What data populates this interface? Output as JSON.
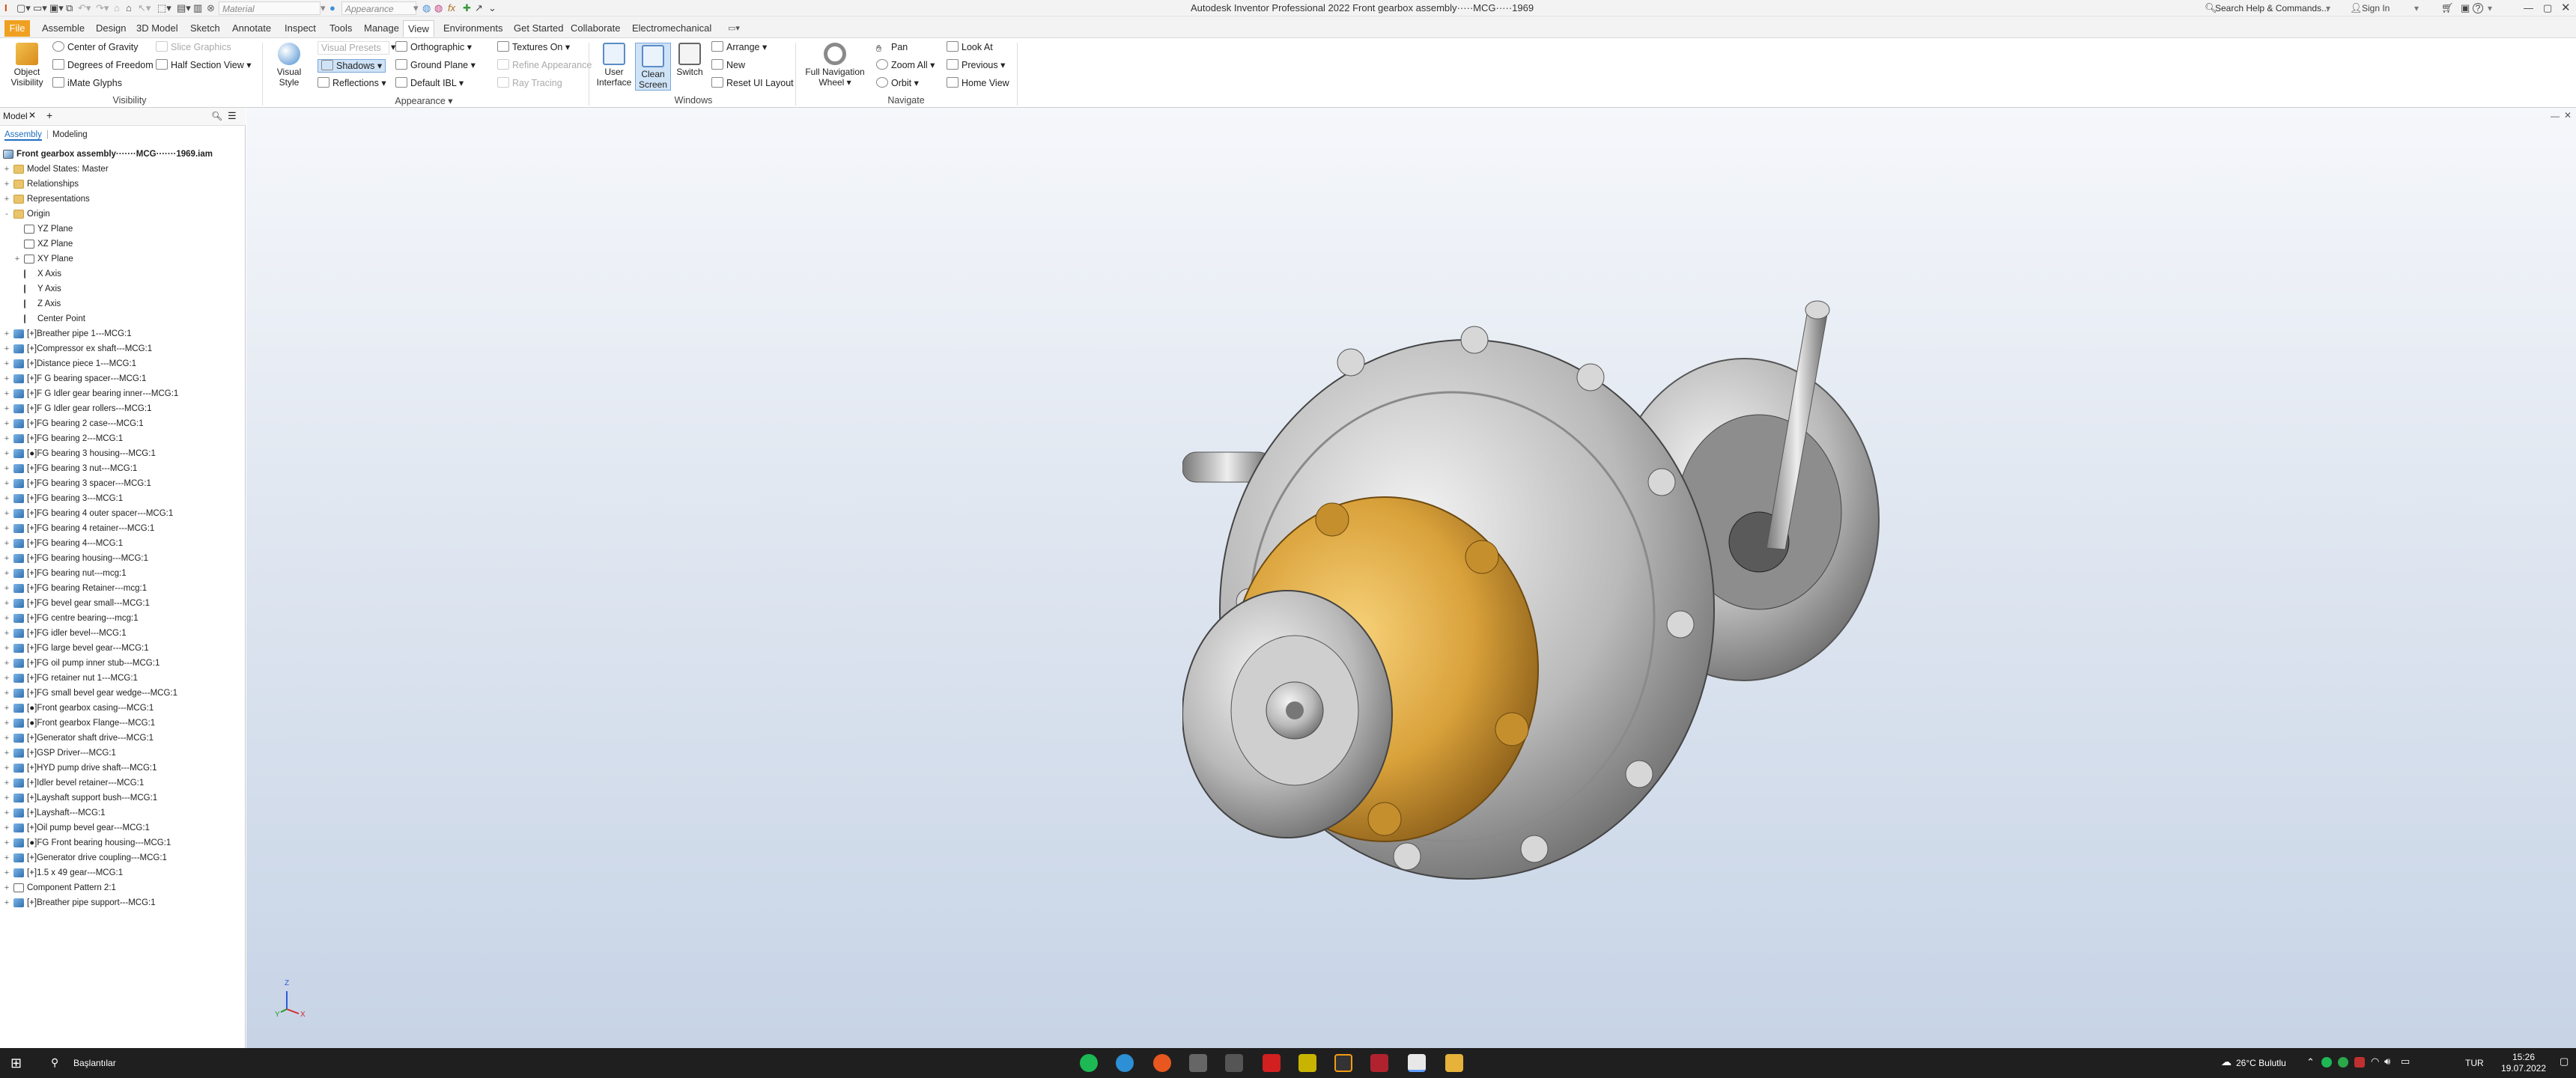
{
  "quick_access": {
    "material_dropdown": "Material",
    "appearance_dropdown": "Appearance"
  },
  "window": {
    "title": "Autodesk Inventor Professional 2022   Front gearbox assembly·····MCG·····1969",
    "search_placeholder": "Search Help & Commands...",
    "sign_in": "Sign In",
    "help": "?"
  },
  "tabs": [
    "File",
    "Assemble",
    "Design",
    "3D Model",
    "Sketch",
    "Annotate",
    "Inspect",
    "Tools",
    "Manage",
    "View",
    "Environments",
    "Get Started",
    "Collaborate",
    "Electromechanical"
  ],
  "active_tab": "View",
  "ribbon": {
    "visibility": {
      "label": "Visibility",
      "object_visibility": "Object Visibility",
      "center_of_gravity": "Center of Gravity",
      "degrees_of_freedom": "Degrees of Freedom",
      "imate_glyphs": "iMate Glyphs",
      "slice_graphics": "Slice Graphics",
      "half_section_view": "Half Section View"
    },
    "appearance": {
      "label": "Appearance",
      "visual_style": "Visual Style",
      "visual_presets": "Visual Presets",
      "shadows": "Shadows",
      "reflections": "Reflections",
      "orthographic": "Orthographic",
      "ground_plane": "Ground Plane",
      "default_ibl": "Default IBL",
      "textures_on": "Textures On",
      "refine_appearance": "Refine Appearance",
      "ray_tracing": "Ray Tracing"
    },
    "windows": {
      "label": "Windows",
      "user_interface": "User Interface",
      "clean_screen": "Clean Screen",
      "switch": "Switch",
      "arrange": "Arrange",
      "new": "New",
      "reset_ui_layout": "Reset UI Layout"
    },
    "navigate": {
      "label": "Navigate",
      "full_navigation_wheel": "Full Navigation Wheel",
      "pan": "Pan",
      "zoom_all": "Zoom All",
      "orbit": "Orbit",
      "look_at": "Look At",
      "previous": "Previous",
      "home_view": "Home View"
    }
  },
  "browser": {
    "tab_label": "Model",
    "add_tab": "+",
    "subtabs": [
      "Assembly",
      "Modeling"
    ],
    "root": "Front gearbox assembly·······MCG·······1969.iam",
    "tree": [
      {
        "label": "Model States: Master",
        "icon": "folder",
        "expand": "+"
      },
      {
        "label": "Relationships",
        "icon": "folder",
        "expand": "+"
      },
      {
        "label": "Representations",
        "icon": "folder",
        "expand": "+"
      },
      {
        "label": "Origin",
        "icon": "folder",
        "expand": "-"
      },
      {
        "label": "YZ Plane",
        "icon": "plane",
        "indent": 1
      },
      {
        "label": "XZ Plane",
        "icon": "plane",
        "indent": 1
      },
      {
        "label": "XY Plane",
        "icon": "plane",
        "indent": 1,
        "expand": "+"
      },
      {
        "label": "X Axis",
        "icon": "axis",
        "indent": 1
      },
      {
        "label": "Y Axis",
        "icon": "axis",
        "indent": 1
      },
      {
        "label": "Z Axis",
        "icon": "axis",
        "indent": 1
      },
      {
        "label": "Center Point",
        "icon": "point",
        "indent": 1
      },
      {
        "label": "[+]Breather pipe 1---MCG:1",
        "icon": "part",
        "expand": "+"
      },
      {
        "label": "[+]Compressor ex shaft---MCG:1",
        "icon": "part",
        "expand": "+"
      },
      {
        "label": "[+]Distance piece 1---MCG:1",
        "icon": "part",
        "expand": "+"
      },
      {
        "label": "[+]F G bearing spacer---MCG:1",
        "icon": "part",
        "expand": "+"
      },
      {
        "label": "[+]F G Idler gear bearing inner---MCG:1",
        "icon": "part",
        "expand": "+"
      },
      {
        "label": "[+]F G Idler gear rollers---MCG:1",
        "icon": "part",
        "expand": "+"
      },
      {
        "label": "[+]FG bearing 2 case---MCG:1",
        "icon": "part",
        "expand": "+"
      },
      {
        "label": "[+]FG bearing 2---MCG:1",
        "icon": "part",
        "expand": "+"
      },
      {
        "label": "[●]FG bearing 3 housing---MCG:1",
        "icon": "part",
        "expand": "+"
      },
      {
        "label": "[+]FG bearing 3 nut---MCG:1",
        "icon": "part",
        "expand": "+"
      },
      {
        "label": "[+]FG bearing 3 spacer---MCG:1",
        "icon": "part",
        "expand": "+"
      },
      {
        "label": "[+]FG bearing 3---MCG:1",
        "icon": "part",
        "expand": "+"
      },
      {
        "label": "[+]FG bearing 4 outer spacer---MCG:1",
        "icon": "part",
        "expand": "+"
      },
      {
        "label": "[+]FG bearing 4 retainer---MCG:1",
        "icon": "part",
        "expand": "+"
      },
      {
        "label": "[+]FG bearing 4---MCG:1",
        "icon": "part",
        "expand": "+"
      },
      {
        "label": "[+]FG bearing housing---MCG:1",
        "icon": "part",
        "expand": "+"
      },
      {
        "label": "[+]FG bearing nut---mcg:1",
        "icon": "part",
        "expand": "+"
      },
      {
        "label": "[+]FG bearing Retainer---mcg:1",
        "icon": "part",
        "expand": "+"
      },
      {
        "label": "[+]FG bevel gear small---MCG:1",
        "icon": "part",
        "expand": "+"
      },
      {
        "label": "[+]FG centre bearing---mcg:1",
        "icon": "part",
        "expand": "+"
      },
      {
        "label": "[+]FG idler bevel---MCG:1",
        "icon": "part",
        "expand": "+"
      },
      {
        "label": "[+]FG large bevel gear---MCG:1",
        "icon": "part",
        "expand": "+"
      },
      {
        "label": "[+]FG oil pump inner stub---MCG:1",
        "icon": "part",
        "expand": "+"
      },
      {
        "label": "[+]FG retainer nut 1---MCG:1",
        "icon": "part",
        "expand": "+"
      },
      {
        "label": "[+]FG small bevel gear wedge---MCG:1",
        "icon": "part",
        "expand": "+"
      },
      {
        "label": "[●]Front gearbox casing---MCG:1",
        "icon": "part",
        "expand": "+"
      },
      {
        "label": "[●]Front gearbox Flange---MCG:1",
        "icon": "part",
        "expand": "+"
      },
      {
        "label": "[+]Generator shaft drive---MCG:1",
        "icon": "part",
        "expand": "+"
      },
      {
        "label": "[+]GSP Driver---MCG:1",
        "icon": "part",
        "expand": "+"
      },
      {
        "label": "[+]HYD pump drive shaft---MCG:1",
        "icon": "part",
        "expand": "+"
      },
      {
        "label": "[+]Idler bevel retainer---MCG:1",
        "icon": "part",
        "expand": "+"
      },
      {
        "label": "[+]Layshaft support bush---MCG:1",
        "icon": "part",
        "expand": "+"
      },
      {
        "label": "[+]Layshaft---MCG:1",
        "icon": "part",
        "expand": "+"
      },
      {
        "label": "[+]Oil pump bevel gear---MCG:1",
        "icon": "part",
        "expand": "+"
      },
      {
        "label": "[●]FG Front bearing housing---MCG:1",
        "icon": "part",
        "expand": "+"
      },
      {
        "label": "[+]Generator drive coupling---MCG:1",
        "icon": "part",
        "expand": "+"
      },
      {
        "label": "[+]1.5 x 49 gear---MCG:1",
        "icon": "part",
        "expand": "+"
      },
      {
        "label": "Component Pattern 2:1",
        "icon": "pattern",
        "expand": "+"
      },
      {
        "label": "[+]Breather pipe support---MCG:1",
        "icon": "part",
        "expand": "+"
      }
    ]
  },
  "viewcube": {
    "x": "X",
    "y": "Y",
    "z": "Z"
  },
  "taskbar": {
    "search_label": "Başlantılar",
    "weather": "26°C  Bulutlu",
    "language": "TUR",
    "time": "15:26",
    "date": "19.07.2022"
  }
}
